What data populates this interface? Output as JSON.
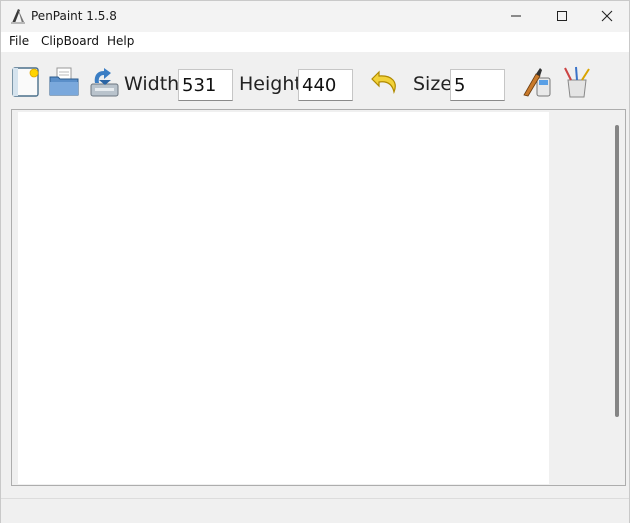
{
  "window": {
    "title": "PenPaint 1.5.8"
  },
  "menu": {
    "file": "File",
    "clipboard": "ClipBoard",
    "help": "Help"
  },
  "toolbar": {
    "width_label": "Width",
    "width_value": "531",
    "height_label": "Height",
    "height_value": "440",
    "size_label": "Size",
    "size_value": "5"
  },
  "icons": {
    "app": "pen-paint-icon",
    "new": "new-document-icon",
    "open": "open-folder-icon",
    "save": "save-disk-icon",
    "undo": "undo-icon",
    "pen": "pen-brush-icon",
    "tools": "brushes-cup-icon"
  },
  "colors": {
    "canvas": "#ffffff",
    "chrome": "#f0f0f0"
  }
}
